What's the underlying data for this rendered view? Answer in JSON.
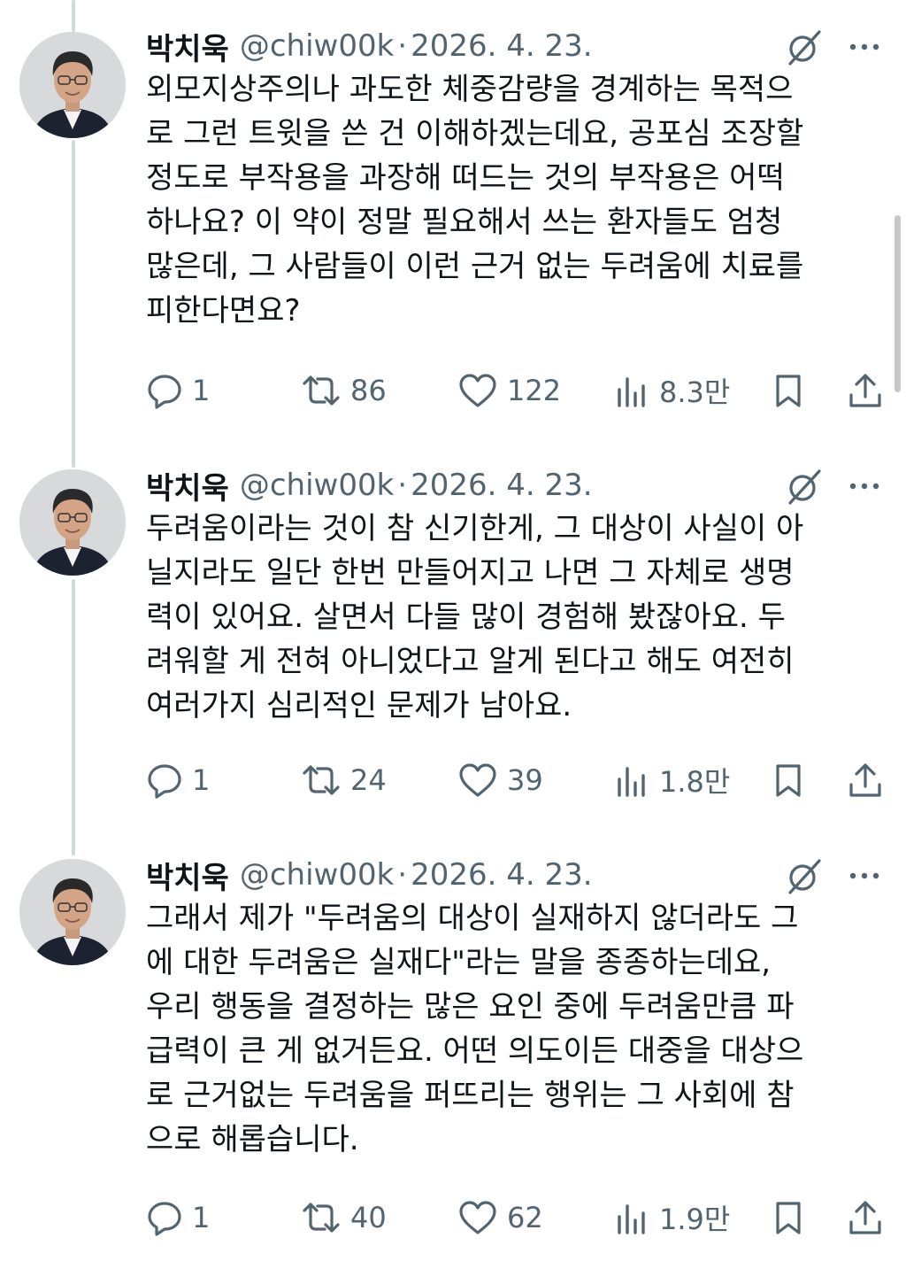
{
  "tweets": [
    {
      "author_name": "박치욱",
      "handle": "@chiw00k",
      "separator": "·",
      "date": "2026. 4. 23.",
      "text": "외모지상주의나 과도한 체중감량을 경계하는 목적으\n로 그런 트윗을 쓴 건 이해하겠는데요, 공포심 조장할\n정도로 부작용을 과장해 떠드는 것의 부작용은 어떡\n하나요? 이 약이 정말 필요해서 쓰는 환자들도 엄청\n많은데, 그 사람들이 이런 근거 없는 두려움에 치료를\n피한다면요?",
      "replies": "1",
      "reposts": "86",
      "likes": "122",
      "views": "8.3만"
    },
    {
      "author_name": "박치욱",
      "handle": "@chiw00k",
      "separator": "·",
      "date": "2026. 4. 23.",
      "text": "두려움이라는 것이 참 신기한게, 그 대상이 사실이 아\n닐지라도 일단 한번 만들어지고 나면 그 자체로 생명\n력이 있어요. 살면서 다들 많이 경험해 봤잖아요. 두\n려워할 게 전혀 아니었다고 알게 된다고 해도 여전히\n여러가지 심리적인 문제가 남아요.",
      "replies": "1",
      "reposts": "24",
      "likes": "39",
      "views": "1.8만"
    },
    {
      "author_name": "박치욱",
      "handle": "@chiw00k",
      "separator": "·",
      "date": "2026. 4. 23.",
      "text": "그래서 제가 \"두려움의 대상이 실재하지 않더라도 그\n에 대한 두려움은 실재다\"라는 말을 종종하는데요,\n우리 행동을 결정하는 많은 요인 중에 두려움만큼 파\n급력이 큰 게 없거든요. 어떤 의도이든 대중을 대상으\n로 근거없는 두려움을 퍼뜨리는 행위는 그 사회에 참\n으로 해롭습니다.",
      "replies": "1",
      "reposts": "40",
      "likes": "62",
      "views": "1.9만"
    }
  ],
  "icons": {
    "reply": "reply-icon",
    "repost": "repost-icon",
    "like": "heart-icon",
    "views": "views-icon",
    "bookmark": "bookmark-icon",
    "share": "share-icon",
    "grok": "grok-icon",
    "more": "more-icon"
  },
  "colors": {
    "text": "#0f1419",
    "secondary": "#536471",
    "thread_line": "#cfd9de"
  }
}
